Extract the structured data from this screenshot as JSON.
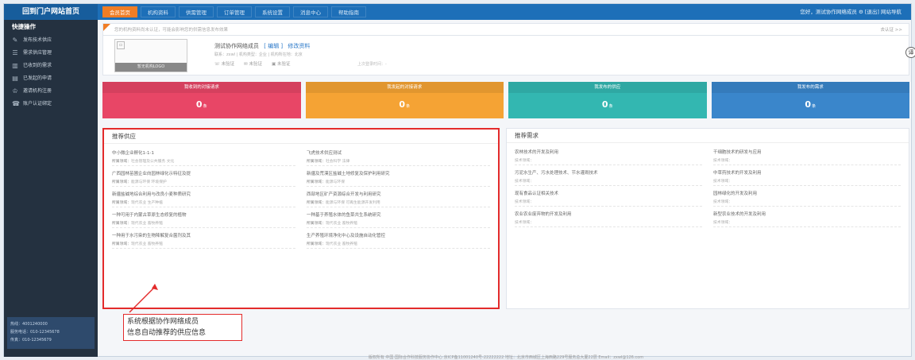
{
  "topbar": {
    "brand": "回到门户网站首页",
    "nav": [
      "会员首页",
      "机构资料",
      "供需管理",
      "订单管理",
      "系统设置",
      "消息中心",
      "帮助指南"
    ],
    "user": "您好，测试协作网络成员 ⚙ [退出] 网站导航"
  },
  "sidebar": {
    "title": "快捷操作",
    "items": [
      {
        "icon": "✎",
        "icon_name": "pencil-icon",
        "label": "发布技术供应"
      },
      {
        "icon": "☰",
        "icon_name": "list-icon",
        "label": "需求供应管理"
      },
      {
        "icon": "▥",
        "icon_name": "building-icon",
        "label": "已收到的需求"
      },
      {
        "icon": "▤",
        "icon_name": "document-icon",
        "label": "已发起的申请"
      },
      {
        "icon": "♔",
        "icon_name": "user-icon",
        "label": "邀请机构注册"
      },
      {
        "icon": "☎",
        "icon_name": "phone-icon",
        "label": "账户认证绑定"
      }
    ],
    "foot": [
      "热线：4001240000",
      "服务电话：010-12345678",
      "传真：010-12345679"
    ]
  },
  "notice": {
    "text": "您的机构资料尚未认证，可能会影响您的供需信息发布效果",
    "more": "去认证 >>"
  },
  "profile": {
    "logo_caption": "暂无机构LOGO",
    "name": "测试协作网络成员",
    "edit_link": "[ 编辑 ]",
    "detail_link": "修改资料",
    "info": "联系：zxwl  |  机构类型：企业  |  机构所在地：北京",
    "certs": [
      "未验证",
      "未验证",
      "未验证"
    ],
    "extra": "上次登录时间：-",
    "translate": "译"
  },
  "stats": [
    {
      "label": "我收到的对接请求",
      "value": "0",
      "unit": "条",
      "color": "#e84666"
    },
    {
      "label": "我发起的对接请求",
      "value": "0",
      "unit": "条",
      "color": "#f5a334"
    },
    {
      "label": "我发布的供应",
      "value": "0",
      "unit": "条",
      "color": "#33b7b1"
    },
    {
      "label": "我发布的需求",
      "value": "0",
      "unit": "条",
      "color": "#3a86cb"
    }
  ],
  "supply": {
    "title": "推荐供应",
    "items": [
      {
        "title": "中小微企业孵化1-1-1",
        "sub": "社会管理及公共服务 文化"
      },
      {
        "title": "飞虎技术供应测试",
        "sub": "社会科学 法律"
      },
      {
        "title": "广西园林苗圃企业向园林绿化示特征及提",
        "sub": "能源与环保 环境保护"
      },
      {
        "title": "新疆及荒漠区盐碱土地修复及保护利用研究",
        "sub": "能源与环保"
      },
      {
        "title": "新疆盐碱地综合利用与改良小麦种质研究",
        "sub": "现代农业 生产种植"
      },
      {
        "title": "西部地区矿产资源综合开发与利用研究",
        "sub": "能源与环保 可再生能源开发利用"
      },
      {
        "title": "一种可用于内蒙古草原生态修复的植物",
        "sub": "现代农业 畜牧养殖"
      },
      {
        "title": "一种基于养殖水体的鱼菜共生系统研究",
        "sub": "现代农业 畜牧养殖"
      },
      {
        "title": "一种用于水污染的生物降解复合菌剂及其",
        "sub": "现代农业 畜牧养殖"
      },
      {
        "title": "生产养殖环境净化中心及设施自动化管控",
        "sub": "现代农业 畜牧养殖"
      }
    ],
    "sub_prefix": "所属领域："
  },
  "demand": {
    "title": "推荐需求",
    "items": [
      {
        "title": "农林技术的开发及利用",
        "sub": "技术领域："
      },
      {
        "title": "干细胞技术的研发与应用",
        "sub": "技术领域："
      },
      {
        "title": "污泥水生产、污水处理技术、节水灌溉技术",
        "sub": "技术领域："
      },
      {
        "title": "中草药技术的开发及利用",
        "sub": "技术领域："
      },
      {
        "title": "现有食品认证相关技术",
        "sub": "技术领域："
      },
      {
        "title": "园林绿化的开发及利用",
        "sub": "技术领域："
      },
      {
        "title": "农业农业废弃物的开发及利用",
        "sub": "技术领域："
      },
      {
        "title": "新型农业技术的开发及利用",
        "sub": "技术领域："
      }
    ]
  },
  "annotation": {
    "line1": "系统根据协作网络成员",
    "line2": "信息自动推荐的供应信息"
  },
  "footer": "版权所有 中国·国际合作科技服务协作中心  京ICP备11001240号-22222222  地址：北京市西城区上海西路229号服务总大厦22层 Email：zxwl@126.com"
}
